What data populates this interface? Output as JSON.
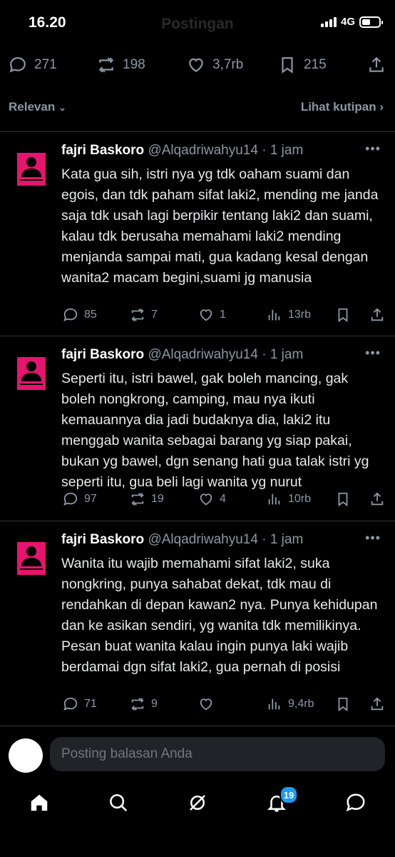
{
  "status_bar": {
    "time": "16.20",
    "network": "4G",
    "battery_level": 0.5
  },
  "header": {
    "title": "Postingan"
  },
  "stats": {
    "replies": "271",
    "reposts": "198",
    "likes": "3,7rb",
    "bookmarks": "215"
  },
  "sort": {
    "label": "Relevan",
    "quotes_label": "Lihat kutipan"
  },
  "tweets": [
    {
      "name": "fajri Baskoro",
      "handle": "@Alqadriwahyu14",
      "time": "· 1 jam",
      "text": "Kata gua sih, istri nya yg tdk oaham suami dan egois, dan tdk paham sifat laki2, mending me janda saja tdk usah lagi berpikir tentang laki2 dan suami, kalau tdk berusaha memahami laki2 mending menjanda sampai mati, gua kadang kesal dengan wanita2 macam begini,suami jg manusia",
      "replies": "85",
      "reposts": "7",
      "likes": "1",
      "views": "13rb"
    },
    {
      "name": "fajri Baskoro",
      "handle": "@Alqadriwahyu14",
      "time": "· 1 jam",
      "text": "Seperti itu, istri bawel, gak boleh mancing, gak boleh nongkrong, camping, mau nya ikuti kemauannya dia jadi budaknya dia, laki2 itu menggab wanita sebagai barang yg siap pakai, bukan yg bawel, dgn senang hati gua talak istri yg seperti itu, gua beli lagi wanita yg nurut",
      "replies": "97",
      "reposts": "19",
      "likes": "4",
      "views": "10rb"
    },
    {
      "name": "fajri Baskoro",
      "handle": "@Alqadriwahyu14",
      "time": "· 1 jam",
      "text": "Wanita itu wajib memahami sifat laki2, suka nongkring, punya sahabat dekat, tdk mau di rendahkan di depan kawan2 nya. Punya kehidupan dan ke asikan sendiri, yg wanita tdk memilikinya. Pesan buat wanita kalau ingin punya laki wajib berdamai dgn sifat laki2, gua pernah di posisi",
      "replies": "71",
      "reposts": "9",
      "likes": "",
      "views": "9,4rb"
    }
  ],
  "reply": {
    "placeholder": "Posting balasan Anda"
  },
  "nav": {
    "notifications_badge": "19"
  },
  "colors": {
    "accent": "#1d9bf0",
    "avatar_bg": "#e6136f",
    "muted": "#8b98a5"
  }
}
